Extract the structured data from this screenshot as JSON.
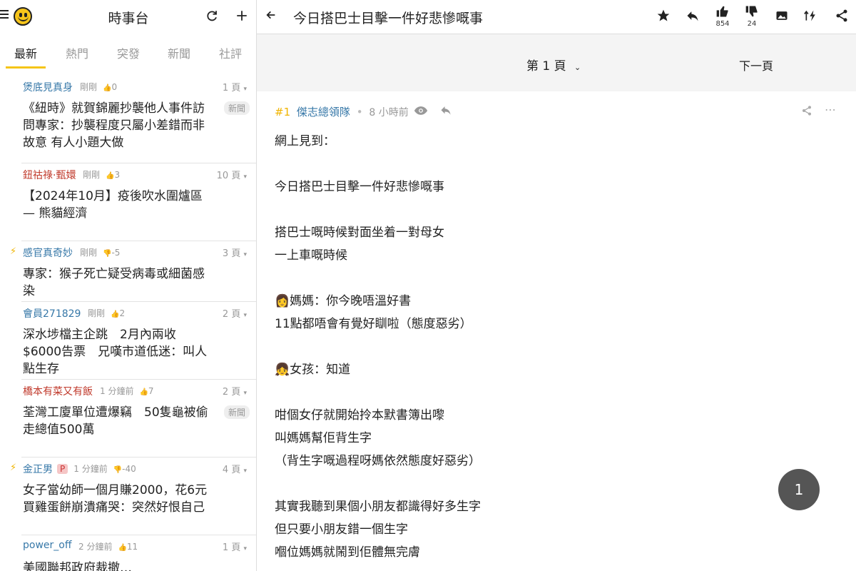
{
  "left": {
    "channel_title": "時事台",
    "tabs": [
      "最新",
      "熱門",
      "突發",
      "新聞",
      "社評"
    ],
    "threads": [
      {
        "user": "煲底見真身",
        "user_color": "#3778a8",
        "time": "剛剛",
        "likes": "0",
        "pages": "1 頁",
        "title": "《紐時》就賀錦麗抄襲他人事件訪問專家：抄襲程度只屬小差錯而非故意 有人小題大做",
        "badge": "新聞",
        "bolt": false,
        "p": false
      },
      {
        "user": "鈕祜祿·甄嬛",
        "user_color": "#c0392b",
        "time": "剛剛",
        "likes": "3",
        "pages": "10 頁",
        "title": "【2024年10月】疫後吹水圍爐區 — 熊貓經濟",
        "badge": "",
        "bolt": false,
        "p": false
      },
      {
        "user": "感官真奇妙",
        "user_color": "#3778a8",
        "time": "剛剛",
        "likes": "-5",
        "pages": "3 頁",
        "title": "專家：猴子死亡疑受病毒或細菌感染",
        "badge": "",
        "bolt": true,
        "p": false
      },
      {
        "user": "會員271829",
        "user_color": "#3778a8",
        "time": "剛剛",
        "likes": "2",
        "pages": "2 頁",
        "title": "深水埗檔主企跳　2月內兩收$6000告票　兄嘆市道低迷：叫人點生存",
        "badge": "",
        "bolt": false,
        "p": false
      },
      {
        "user": "橋本有菜又有飯",
        "user_color": "#c0392b",
        "time": "1 分鐘前",
        "likes": "7",
        "pages": "2 頁",
        "title": "荃灣工廈單位遭爆竊　50隻龜被偷走總值500萬",
        "badge": "新聞",
        "bolt": false,
        "p": false
      },
      {
        "user": "金正男",
        "user_color": "#3778a8",
        "time": "1 分鐘前",
        "likes": "-40",
        "pages": "4 頁",
        "title": "女子當幼師一個月賺2000，花6元買雞蛋餅崩潰痛哭：突然好恨自己",
        "badge": "",
        "bolt": true,
        "p": true
      },
      {
        "user": "power_off",
        "user_color": "#3778a8",
        "time": "2 分鐘前",
        "likes": "11",
        "pages": "1 頁",
        "title": "美國聯邦政府裁撤…",
        "badge": "",
        "bolt": false,
        "p": false
      }
    ],
    "p_label": "P"
  },
  "right": {
    "thread_title": "今日搭巴士目擊一件好悲慘嘅事",
    "like_count": "854",
    "dislike_count": "24",
    "page_label": "第 1 頁",
    "next_page": "下一頁",
    "post": {
      "floor": "#1",
      "author": "傑志總領隊",
      "time": "8 小時前",
      "body": "網上見到：\n\n今日搭巴士目擊一件好悲慘嘅事\n\n搭巴士嘅時候對面坐着一對母女\n一上車嘅時候\n\n👩媽媽：你今晚唔溫好書\n11點都唔會有覺好瞓啦（態度惡劣）\n\n👧女孩：知道\n\n咁個女仔就開始拎本默書簿出嚟\n叫媽媽幫佢背生字\n（背生字嘅過程呀媽依然態度好惡劣）\n\n其實我聽到果個小朋友都識得好多生字\n但只要小朋友錯一個生字\n嗰位媽媽就鬧到佢體無完膚"
    },
    "fab_label": "1"
  }
}
